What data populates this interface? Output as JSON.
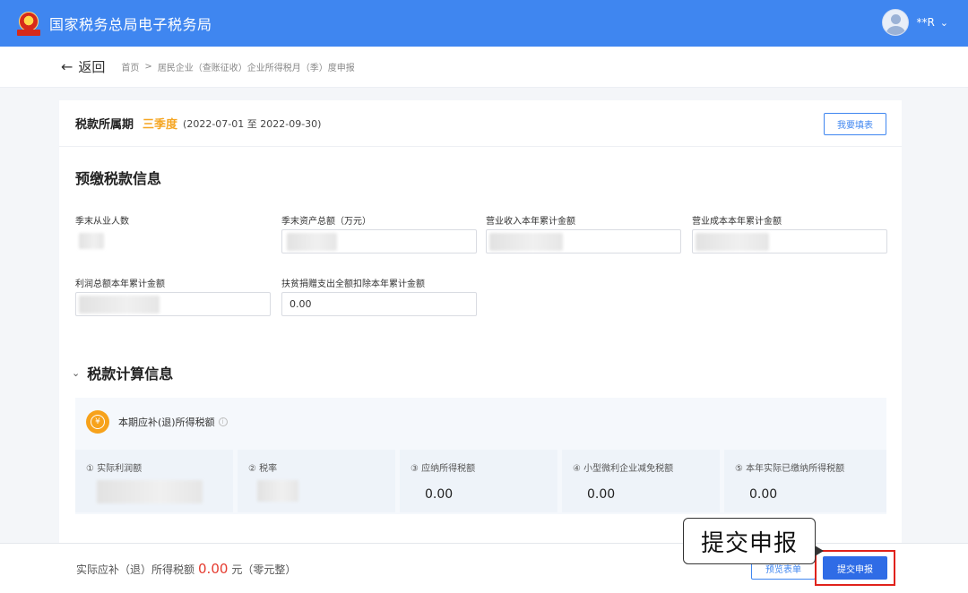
{
  "header": {
    "site_title": "国家税务总局电子税务局",
    "user_name": "**R",
    "user_chevron": "⌄"
  },
  "breadcrumb": {
    "back_label": "返回",
    "items": [
      "首页",
      "居民企业（查账征收）企业所得税月（季）度申报"
    ],
    "separator": ">"
  },
  "period": {
    "label": "税款所属期",
    "quarter": "三季度",
    "range": "(2022-07-01 至 2022-09-30)",
    "fill_button": "我要填表"
  },
  "prepay_section": {
    "title": "预缴税款信息",
    "fields": [
      {
        "label": "季末从业人数",
        "value": ""
      },
      {
        "label": "季末资产总额（万元）",
        "value": ""
      },
      {
        "label": "营业收入本年累计金额",
        "value": ""
      },
      {
        "label": "营业成本本年累计金额",
        "value": ""
      },
      {
        "label": "利润总额本年累计金额",
        "value": ""
      },
      {
        "label": "扶贫捐赠支出全额扣除本年累计金额",
        "value": "0.00"
      }
    ]
  },
  "calc_section": {
    "chevron": "⌄",
    "title": "税款计算信息",
    "summary_label": "本期应补(退)所得税额",
    "summary_icon": "¥",
    "metrics": [
      {
        "label": "① 实际利润额",
        "value": ""
      },
      {
        "label": "② 税率",
        "value": ""
      },
      {
        "label": "③ 应纳所得税额",
        "value": "0.00"
      },
      {
        "label": "④ 小型微利企业减免税额",
        "value": "0.00"
      },
      {
        "label": "⑤ 本年实际已缴纳所得税额",
        "value": "0.00"
      }
    ]
  },
  "footer": {
    "prefix": "实际应补（退）所得税额",
    "amount": "0.00",
    "suffix": "元（零元整）",
    "preview_button": "预览表单",
    "submit_button": "提交申报",
    "callout": "提交申报"
  },
  "colors": {
    "brand_blue": "#3f86f0",
    "accent_orange": "#f5a623",
    "highlight_red": "#e0221b"
  }
}
